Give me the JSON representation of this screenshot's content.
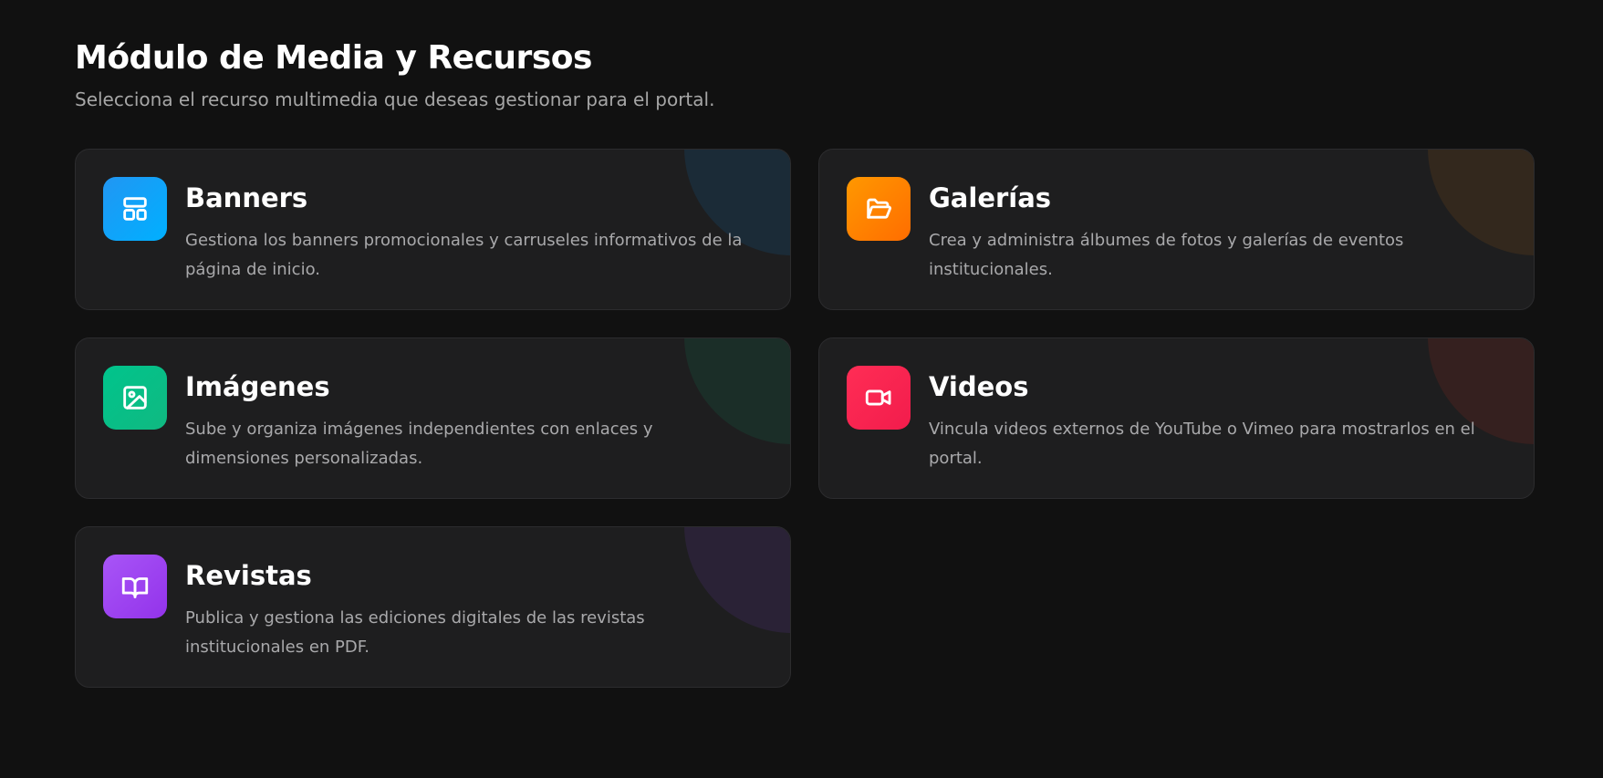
{
  "header": {
    "title": "Módulo de Media y Recursos",
    "subtitle": "Selecciona el recurso multimedia que deseas gestionar para el portal."
  },
  "cards": [
    {
      "title": "Banners",
      "description": "Gestiona los banners promocionales y carruseles informativos de la página de inicio.",
      "icon": "layout-icon",
      "gradient_start": "#2196f3",
      "gradient_end": "#00b0ff",
      "deco_color": "#1b2b37"
    },
    {
      "title": "Galerías",
      "description": "Crea y administra álbumes de fotos y galerías de eventos institucionales.",
      "icon": "folder-open-icon",
      "gradient_start": "#ff9800",
      "gradient_end": "#ff6d00",
      "deco_color": "#33281d"
    },
    {
      "title": "Imágenes",
      "description": "Sube y organiza imágenes independientes con enlaces y dimensiones personalizadas.",
      "icon": "image-icon",
      "gradient_start": "#00c48c",
      "gradient_end": "#10b981",
      "deco_color": "#1b2e28"
    },
    {
      "title": "Videos",
      "description": "Vincula videos externos de YouTube o Vimeo para mostrarlos en el portal.",
      "icon": "video-camera-icon",
      "gradient_start": "#ff2d55",
      "gradient_end": "#f21c4c",
      "deco_color": "#35201f"
    },
    {
      "title": "Revistas",
      "description": "Publica y gestiona las ediciones digitales de las revistas institucionales en PDF.",
      "icon": "book-open-icon",
      "gradient_start": "#a855f7",
      "gradient_end": "#9333ea",
      "deco_color": "#2a2236"
    }
  ]
}
